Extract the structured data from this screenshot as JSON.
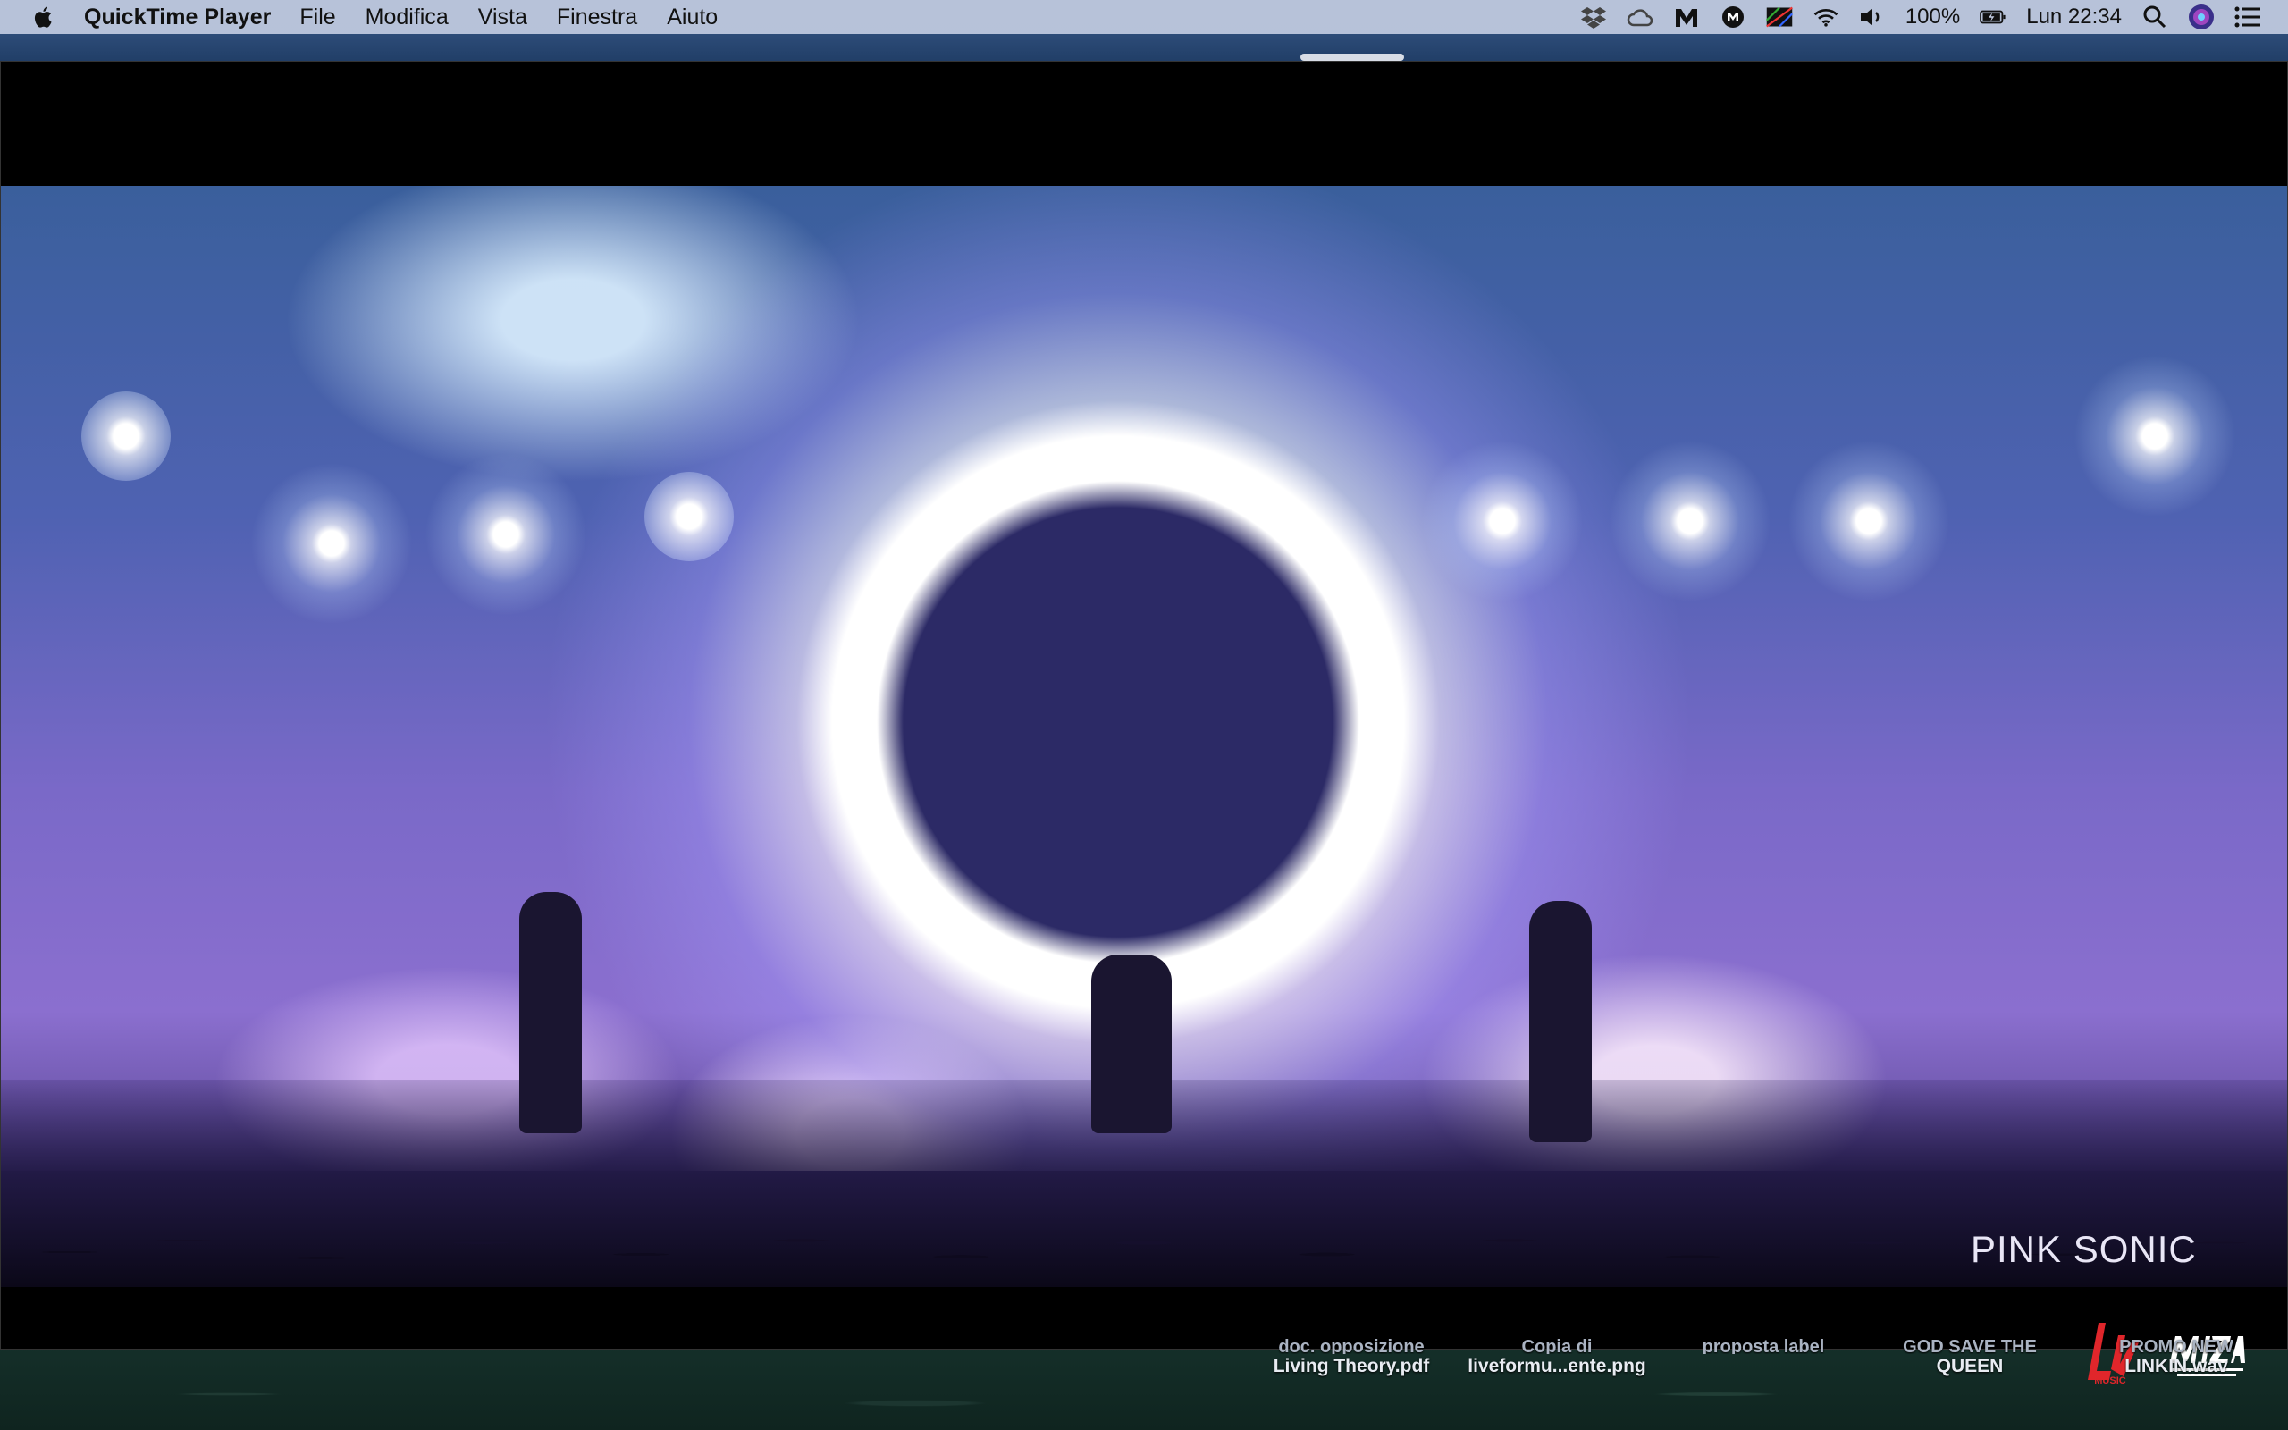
{
  "menubar": {
    "app_name": "QuickTime Player",
    "menus": [
      "File",
      "Modifica",
      "Vista",
      "Finestra",
      "Aiuto"
    ],
    "status": {
      "battery_text": "100%",
      "clock": "Lun 22:34"
    },
    "status_icons": [
      "dropbox-icon",
      "creative-cloud-icon",
      "malwarebytes-icon",
      "m-circle-icon",
      "display-icon",
      "wifi-icon",
      "volume-icon",
      "battery-icon",
      "spotlight-search-icon",
      "siri-icon",
      "notification-center-icon"
    ]
  },
  "player": {
    "watermark": "PINK SONIC",
    "logos": {
      "left": "Live Music",
      "right": "MIZA"
    }
  },
  "desktop": {
    "files": [
      {
        "line1": "doc. opposizione",
        "line2": "Living Theory.pdf"
      },
      {
        "line1": "Copia di",
        "line2": "liveformu...ente.png"
      },
      {
        "line1": "proposta label",
        "line2": ""
      },
      {
        "line1": "GOD SAVE THE",
        "line2": "QUEEN"
      },
      {
        "line1": "PROMO NEW",
        "line2": "LINKIN.wav"
      }
    ]
  },
  "colors": {
    "menubar_bg": "#c4cee4",
    "player_bg": "#000000",
    "stage_purple": "#7a69c8"
  }
}
